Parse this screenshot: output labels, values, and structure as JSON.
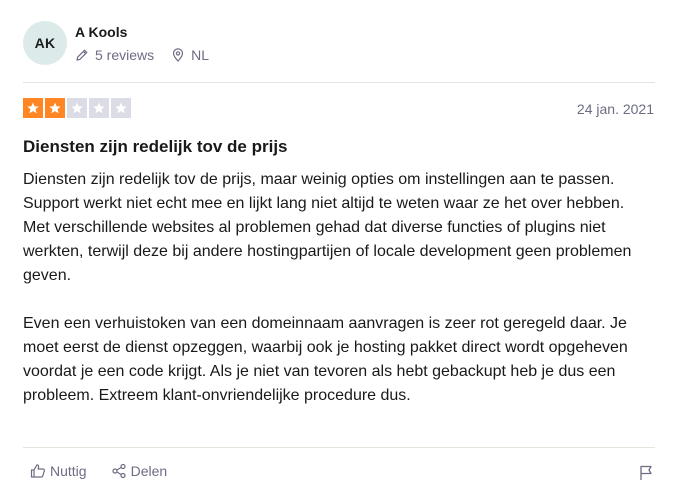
{
  "reviewer": {
    "initials": "AK",
    "name": "A Kools",
    "reviews_count": "5 reviews",
    "country": "NL"
  },
  "review": {
    "rating": 2,
    "max_rating": 5,
    "date": "24 jan. 2021",
    "title": "Diensten zijn redelijk tov de prijs",
    "paragraphs": [
      "Diensten zijn redelijk tov de prijs, maar weinig opties om instellingen aan te passen. Support werkt niet echt mee en lijkt lang niet altijd te weten waar ze het over hebben.",
      "Met verschillende websites al problemen gehad dat diverse functies of plugins niet werkten, terwijl deze bij andere hostingpartijen of locale development geen problemen geven.",
      "Even een verhuistoken van een domeinnaam aanvragen is zeer rot geregeld daar. Je moet eerst de dienst opzeggen, waarbij ook je hosting pakket direct wordt opgeheven voordat je een code krijgt. Als je niet van tevoren als hebt gebackupt heb je dus een probleem. Extreem klant-onvriendelijke procedure dus."
    ]
  },
  "actions": {
    "useful_label": "Nuttig",
    "share_label": "Delen"
  },
  "colors": {
    "star_active": "#ff8622",
    "star_inactive": "#dcdce6",
    "avatar_bg": "#dcebea",
    "muted_text": "#6c6c85"
  },
  "icons": [
    "pencil-icon",
    "location-pin-icon",
    "star-icon",
    "thumbs-up-icon",
    "share-icon",
    "flag-icon"
  ]
}
